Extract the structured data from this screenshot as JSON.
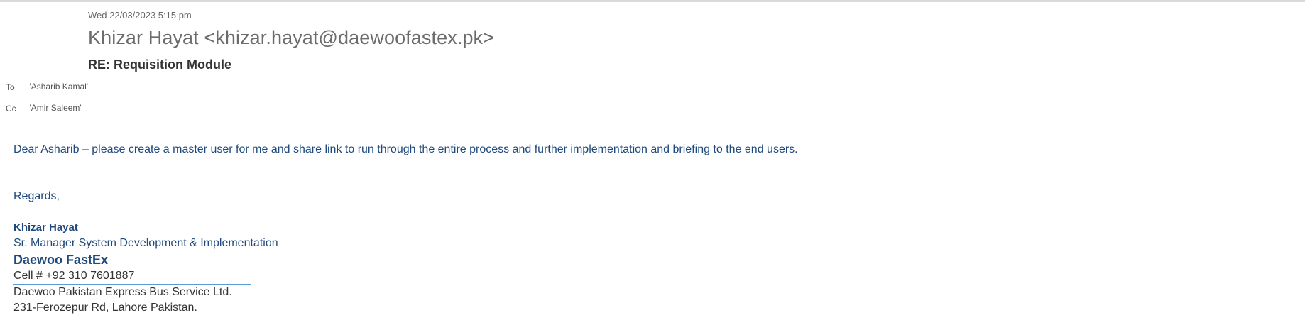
{
  "email": {
    "date": "Wed 22/03/2023 5:15 pm",
    "sender": "Khizar Hayat <khizar.hayat@daewoofastex.pk>",
    "subject": "RE: Requisition Module",
    "to_label": "To",
    "to_value": "'Asharib Kamal'",
    "cc_label": "Cc",
    "cc_value": "'Amir Saleem'"
  },
  "body": {
    "message": "Dear Asharib – please create a master user for me and share link to run through the entire process and further implementation and briefing to the end users.",
    "regards": "Regards,"
  },
  "signature": {
    "name": "Khizar Hayat",
    "title": "Sr. Manager System Development & Implementation",
    "company": "Daewoo FastEx",
    "cell": "Cell # +92 310 7601887",
    "organization": "Daewoo Pakistan Express Bus Service Ltd.",
    "address": "231-Ferozepur Rd, Lahore Pakistan."
  }
}
